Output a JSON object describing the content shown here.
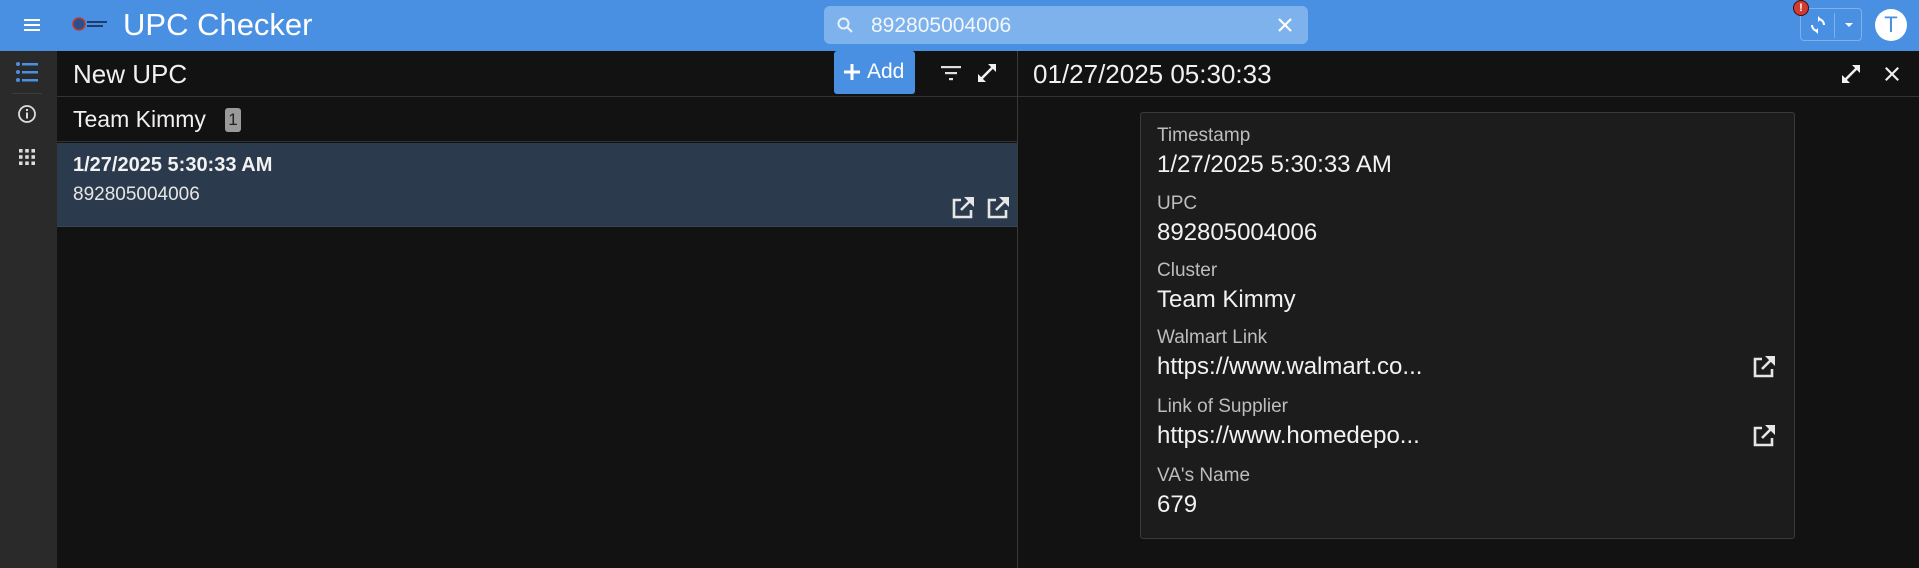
{
  "header": {
    "title": "UPC Checker",
    "search_value": "892805004006",
    "alert_badge": "!",
    "avatar_letter": "T",
    "colors": {
      "bar": "#4a90e2",
      "search_bg": "#7eb2ec"
    }
  },
  "rail": {
    "items": [
      "list-icon",
      "info-icon",
      "apps-grid-icon"
    ]
  },
  "list_panel": {
    "title": "New UPC",
    "add_label": "Add",
    "group": {
      "label": "Team Kimmy",
      "count": "1"
    },
    "records": [
      {
        "timestamp": "1/27/2025 5:30:33 AM",
        "upc": "892805004006"
      }
    ]
  },
  "detail_panel": {
    "title": "01/27/2025 05:30:33",
    "fields": [
      {
        "label": "Timestamp",
        "value": "1/27/2025 5:30:33 AM"
      },
      {
        "label": "UPC",
        "value": "892805004006"
      },
      {
        "label": "Cluster",
        "value": "Team Kimmy"
      },
      {
        "label": "Walmart Link",
        "value": "https://www.walmart.co..."
      },
      {
        "label": "Link of Supplier",
        "value": "https://www.homedepo..."
      },
      {
        "label": "VA's Name",
        "value": "679"
      }
    ]
  }
}
